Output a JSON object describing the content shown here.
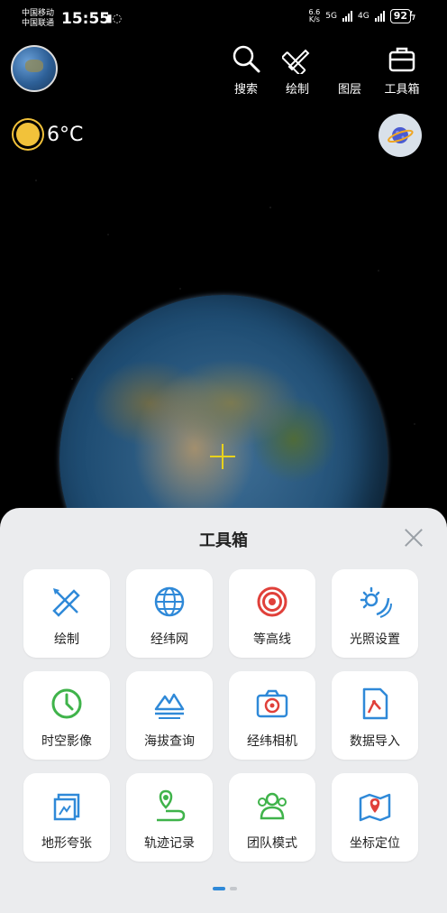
{
  "status_bar": {
    "carrier_1": "中国移动",
    "carrier_2": "中国联通",
    "time": "15:55",
    "net_speed_top": "6.6",
    "net_speed_unit": "K/s",
    "sim1": "5G",
    "sim2": "4G",
    "battery": "92"
  },
  "top_toolbar": {
    "search_label": "搜索",
    "draw_label": "绘制",
    "layers_label": "图层",
    "toolbox_label": "工具箱"
  },
  "weather": {
    "temperature": "6°C",
    "icon": "sun-icon"
  },
  "panel": {
    "title": "工具箱",
    "tools": [
      {
        "label": "绘制",
        "icon": "draw-ruler-icon"
      },
      {
        "label": "经纬网",
        "icon": "globe-grid-icon"
      },
      {
        "label": "等高线",
        "icon": "contour-icon"
      },
      {
        "label": "光照设置",
        "icon": "light-icon"
      },
      {
        "label": "时空影像",
        "icon": "clock-icon"
      },
      {
        "label": "海拔查询",
        "icon": "mountain-icon"
      },
      {
        "label": "经纬相机",
        "icon": "camera-icon"
      },
      {
        "label": "数据导入",
        "icon": "import-icon"
      },
      {
        "label": "地形夸张",
        "icon": "terrain-icon"
      },
      {
        "label": "轨迹记录",
        "icon": "track-icon"
      },
      {
        "label": "团队模式",
        "icon": "team-icon"
      },
      {
        "label": "坐标定位",
        "icon": "locate-icon"
      }
    ],
    "page_index": 1,
    "page_count": 2
  },
  "colors": {
    "accent": "#2f89d8",
    "red": "#e0403a",
    "green": "#3fb34a",
    "panel_bg": "#ebecee"
  }
}
